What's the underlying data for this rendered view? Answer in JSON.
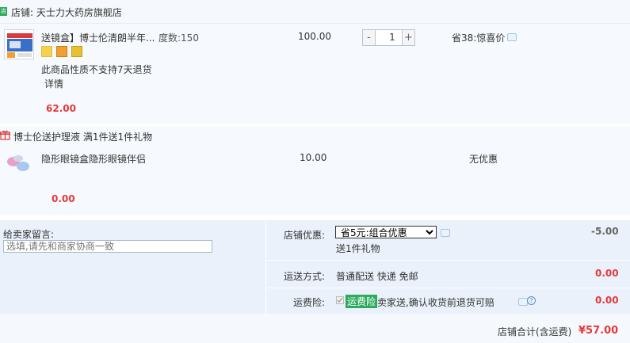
{
  "store": {
    "icon_text": "店",
    "label": "店铺: 天士力大药房旗舰店"
  },
  "item1": {
    "title": "送镜盒】博士伦清朗半年...",
    "spec": "度数:150",
    "price": "100.00",
    "quantity": "1",
    "qty_minus": "-",
    "qty_plus": "+",
    "promo": "省38:惊喜价",
    "notice": "此商品性质不支持7天退货",
    "detail_link": "详情",
    "subtotal": "62.00"
  },
  "gift": {
    "header": "博士伦送护理液    满1件送1件礼物",
    "title": "隐形眼镜盒隐形眼镜伴侣",
    "price": "10.00",
    "promo": "无优惠",
    "subtotal": "0.00"
  },
  "message": {
    "label": "给卖家留言:",
    "placeholder": "选填,请先和商家协商一致"
  },
  "store_discount": {
    "label": "店铺优惠:",
    "selected": "省5元:组合优惠",
    "gift_note": "送1件礼物",
    "amount": "-5.00"
  },
  "shipping": {
    "label": "运送方式:",
    "value": "普通配送 快递 免邮",
    "amount": "0.00"
  },
  "insurance": {
    "label": "运费险:",
    "tag": "运费险",
    "text": "卖家送,确认收货前退货可赔",
    "amount": "0.00",
    "help": "?"
  },
  "total": {
    "label": "店铺合计(含运费)",
    "amount": "¥57.00"
  },
  "colors": {
    "price_red": "#e4393c",
    "accent_green": "#2eaa5d",
    "panel_bg": "#eaf1fa"
  }
}
